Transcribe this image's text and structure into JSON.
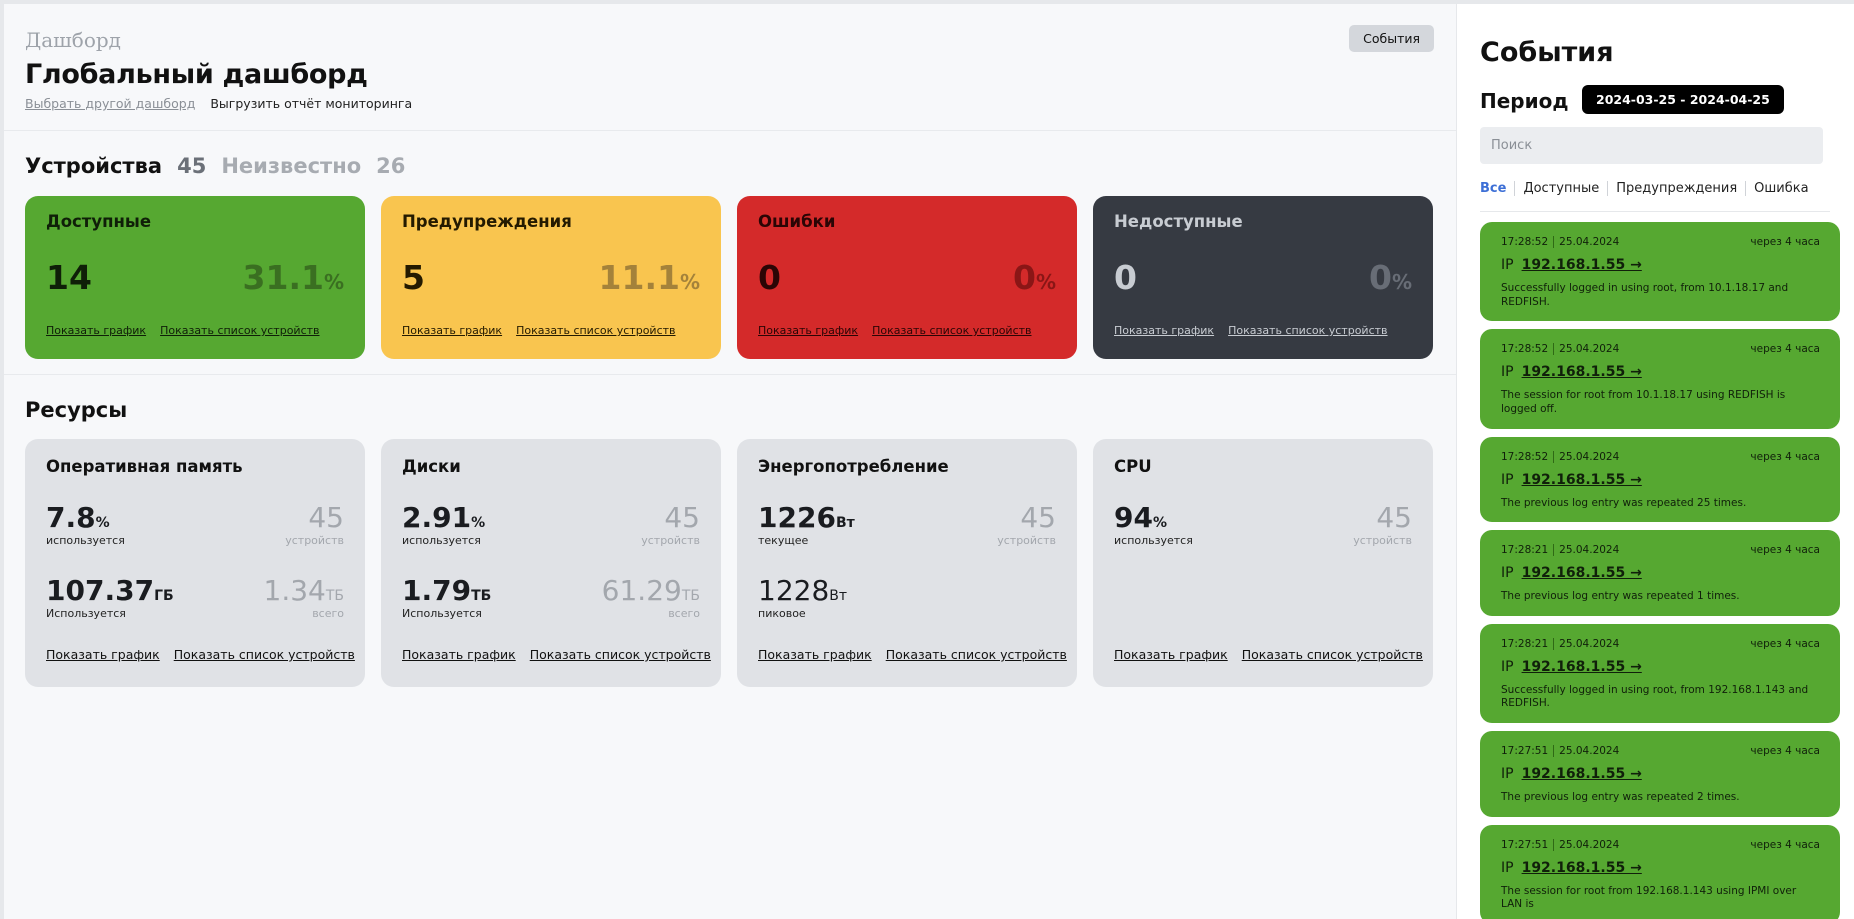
{
  "header": {
    "breadcrumb": "Дашборд",
    "title": "Глобальный дашборд",
    "choose_link": "Выбрать другой дашборд",
    "export_link": "Выгрузить отчёт мониторинга",
    "events_button": "События"
  },
  "devices": {
    "label": "Устройства",
    "count": "45",
    "unknown_label": "Неизвестно",
    "unknown_count": "26",
    "cards": [
      {
        "title": "Доступные",
        "count": "14",
        "pct": "31.1",
        "color": "#56a831"
      },
      {
        "title": "Предупреждения",
        "count": "5",
        "pct": "11.1",
        "color": "#f9c54f"
      },
      {
        "title": "Ошибки",
        "count": "0",
        "pct": "0",
        "color": "#d42a2a"
      },
      {
        "title": "Недоступные",
        "count": "0",
        "pct": "0",
        "color": "#363a42"
      }
    ],
    "pct_unit": "%",
    "show_chart": "Показать график",
    "show_list": "Показать список устройств"
  },
  "resources": {
    "label": "Ресурсы",
    "show_chart": "Показать график",
    "show_list": "Показать список устройств",
    "cards": [
      {
        "title": "Оперативная память",
        "m1_val": "7.8",
        "m1_unit": "%",
        "m1_lbl": "используется",
        "r1_val": "45",
        "r1_lbl": "устройств",
        "m2_val": "107.37",
        "m2_unit": "ГБ",
        "m2_lbl": "Используется",
        "r2_val": "1.34",
        "r2_unit": "ТБ",
        "r2_lbl": "всего"
      },
      {
        "title": "Диски",
        "m1_val": "2.91",
        "m1_unit": "%",
        "m1_lbl": "используется",
        "r1_val": "45",
        "r1_lbl": "устройств",
        "m2_val": "1.79",
        "m2_unit": "ТБ",
        "m2_lbl": "Используется",
        "r2_val": "61.29",
        "r2_unit": "ТБ",
        "r2_lbl": "всего"
      },
      {
        "title": "Энергопотребление",
        "m1_val": "1226",
        "m1_unit": "Вт",
        "m1_lbl": "текущее",
        "r1_val": "45",
        "r1_lbl": "устройств",
        "m2_val": "1228",
        "m2_unit": "Вт",
        "m2_lbl": "пиковое"
      },
      {
        "title": "CPU",
        "m1_val": "94",
        "m1_unit": "%",
        "m1_lbl": "используется",
        "r1_val": "45",
        "r1_lbl": "устройств"
      }
    ]
  },
  "events_panel": {
    "title": "События",
    "period_label": "Период",
    "period_value": "2024-03-25 - 2024-04-25",
    "search_placeholder": "Поиск",
    "filters": [
      "Все",
      "Доступные",
      "Предупреждения",
      "Ошибка"
    ],
    "ip_prefix": "IP",
    "items": [
      {
        "time": "17:28:52",
        "date": "25.04.2024",
        "rel": "через 4 часа",
        "ip": "192.168.1.55 →",
        "msg": "Successfully logged in using root, from 10.1.18.17 and REDFISH."
      },
      {
        "time": "17:28:52",
        "date": "25.04.2024",
        "rel": "через 4 часа",
        "ip": "192.168.1.55 →",
        "msg": "The session for root from 10.1.18.17 using REDFISH is logged off."
      },
      {
        "time": "17:28:52",
        "date": "25.04.2024",
        "rel": "через 4 часа",
        "ip": "192.168.1.55 →",
        "msg": "The previous log entry was repeated 25 times."
      },
      {
        "time": "17:28:21",
        "date": "25.04.2024",
        "rel": "через 4 часа",
        "ip": "192.168.1.55 →",
        "msg": "The previous log entry was repeated 1 times."
      },
      {
        "time": "17:28:21",
        "date": "25.04.2024",
        "rel": "через 4 часа",
        "ip": "192.168.1.55 →",
        "msg": "Successfully logged in using root, from 192.168.1.143 and REDFISH."
      },
      {
        "time": "17:27:51",
        "date": "25.04.2024",
        "rel": "через 4 часа",
        "ip": "192.168.1.55 →",
        "msg": "The previous log entry was repeated 2 times."
      },
      {
        "time": "17:27:51",
        "date": "25.04.2024",
        "rel": "через 4 часа",
        "ip": "192.168.1.55 →",
        "msg": "The session for root from 192.168.1.143 using IPMI over LAN is"
      }
    ]
  }
}
